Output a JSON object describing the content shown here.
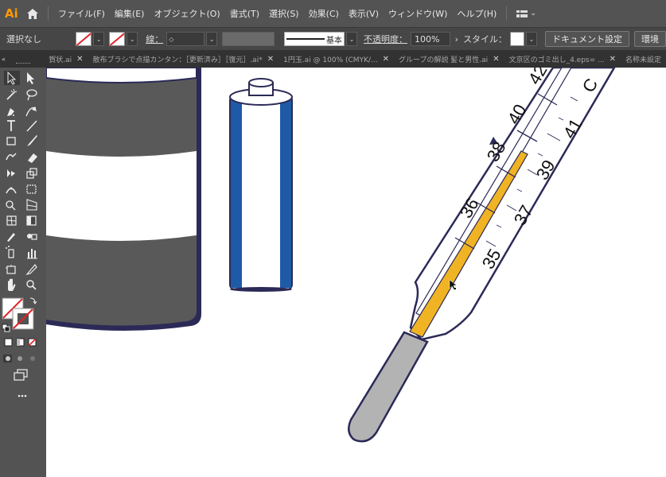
{
  "app": {
    "logo": "Ai"
  },
  "menu": [
    "ファイル(F)",
    "編集(E)",
    "オブジェクト(O)",
    "書式(T)",
    "選択(S)",
    "効果(C)",
    "表示(V)",
    "ウィンドウ(W)",
    "ヘルプ(H)"
  ],
  "control": {
    "selection": "選択なし",
    "stroke_label": "線：",
    "stroke_style": "基本",
    "opacity_label": "不透明度：",
    "opacity_value": "100%",
    "style_label": "スタイル：",
    "doc_settings": "ドキュメント設定",
    "env_settings": "環境"
  },
  "tabs": [
    {
      "label": "賀状.ai"
    },
    {
      "label": "散布ブラシで点描カンタン：［更新済み］［復元］.ai*"
    },
    {
      "label": "1円玉.ai @ 100% (CMYK/..."
    },
    {
      "label": "グループの解説 髪と男性.ai"
    },
    {
      "label": "文京区のゴミ出し_4.eps= ..."
    },
    {
      "label": "名称未設定"
    }
  ],
  "thermometer": {
    "left_scale": [
      "42",
      "40",
      "38",
      "36",
      "35"
    ],
    "right_scale": [
      "C",
      "41",
      "39",
      "37"
    ]
  },
  "colors": {
    "mercury": "#f0b323",
    "outline": "#2b2a57",
    "battery_blue": "#1f5aa6",
    "jar_gray": "#595959",
    "bulb_gray": "#b3b3b3"
  }
}
